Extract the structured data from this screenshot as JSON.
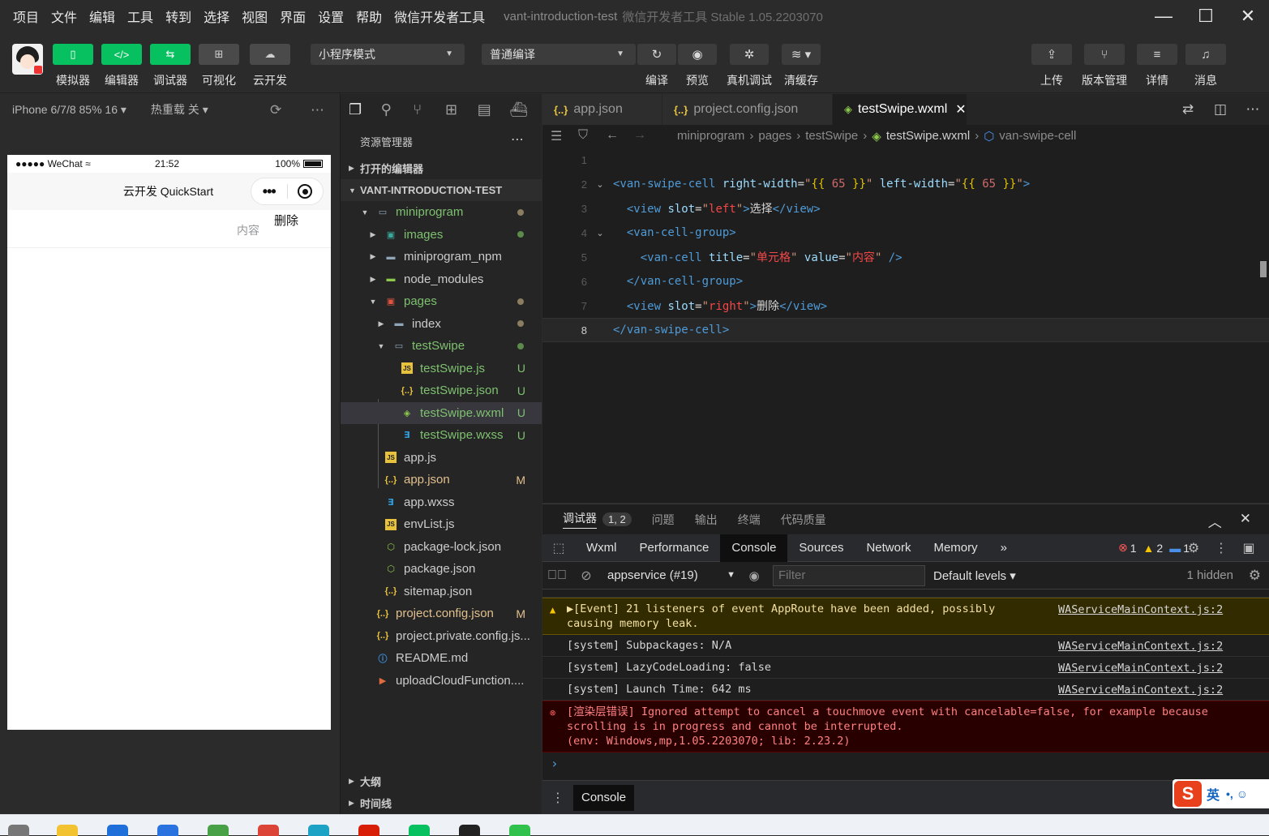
{
  "menubar": {
    "items": [
      "项目",
      "文件",
      "编辑",
      "工具",
      "转到",
      "选择",
      "视图",
      "界面",
      "设置",
      "帮助",
      "微信开发者工具"
    ],
    "title": "vant-introduction-test",
    "subtitle": "微信开发者工具 Stable 1.05.2203070",
    "controls": [
      "—",
      "☐",
      "✕"
    ]
  },
  "toolbar": {
    "left_buttons": [
      {
        "label": "模拟器",
        "icon": "phone-icon",
        "glyph": "▯",
        "active": true
      },
      {
        "label": "编辑器",
        "icon": "code-icon",
        "glyph": "</>",
        "active": true
      },
      {
        "label": "调试器",
        "icon": "debug-icon",
        "glyph": "⇆",
        "active": true
      },
      {
        "label": "可视化",
        "icon": "layout-icon",
        "glyph": "⊞",
        "active": false
      },
      {
        "label": "云开发",
        "icon": "cloud-icon",
        "glyph": "☁",
        "active": false
      }
    ],
    "mode_select": "小程序模式",
    "compile_select": "普通编译",
    "right_labels": [
      "编译",
      "预览",
      "真机调试",
      "清缓存"
    ],
    "far_right": [
      {
        "label": "上传",
        "icon": "upload-icon",
        "glyph": "⇪"
      },
      {
        "label": "版本管理",
        "icon": "branch-icon",
        "glyph": "⑂"
      },
      {
        "label": "详情",
        "icon": "menu-icon",
        "glyph": "≡"
      },
      {
        "label": "消息",
        "icon": "bell-icon",
        "glyph": "♫"
      }
    ]
  },
  "simulator": {
    "device": "iPhone 6/7/8 85% 16 ▾",
    "hot_reload": "热重载 关 ▾",
    "status": {
      "carrier": "●●●●● WeChat",
      "wifi": "≈",
      "time": "21:52",
      "battery": "100%"
    },
    "nav_title": "云开发 QuickStart",
    "cell_value": "内容",
    "delete_label": "删除"
  },
  "explorer": {
    "title": "资源管理器",
    "open_editors": "打开的编辑器",
    "project": "VANT-INTRODUCTION-TEST",
    "tree": [
      {
        "name": "miniprogram",
        "depth": 0,
        "arrow": "▼",
        "icon": "folder-open-icon",
        "color": "#7ec16f",
        "dot": "#8b7d60"
      },
      {
        "name": "images",
        "depth": 1,
        "arrow": "▶",
        "icon": "folder-image-icon",
        "color": "#7ec16f",
        "dot": "#5b8a4a"
      },
      {
        "name": "miniprogram_npm",
        "depth": 1,
        "arrow": "▶",
        "icon": "folder-icon",
        "color": "#cccccc"
      },
      {
        "name": "node_modules",
        "depth": 1,
        "arrow": "▶",
        "icon": "folder-node-icon",
        "color": "#cccccc"
      },
      {
        "name": "pages",
        "depth": 1,
        "arrow": "▼",
        "icon": "folder-pages-icon",
        "color": "#7ec16f",
        "dot": "#8b7d60"
      },
      {
        "name": "index",
        "depth": 2,
        "arrow": "▶",
        "icon": "folder-icon",
        "color": "#cccccc",
        "dot": "#8b7d60"
      },
      {
        "name": "testSwipe",
        "depth": 2,
        "arrow": "▼",
        "icon": "folder-open-icon",
        "color": "#7ec16f",
        "dot": "#5b8a4a"
      },
      {
        "name": "testSwipe.js",
        "depth": 3,
        "icon": "js-file-icon",
        "color": "#7ec16f",
        "status": "U",
        "status_color": "#7ec16f"
      },
      {
        "name": "testSwipe.json",
        "depth": 3,
        "icon": "json-file-icon",
        "color": "#7ec16f",
        "status": "U",
        "status_color": "#7ec16f"
      },
      {
        "name": "testSwipe.wxml",
        "depth": 3,
        "icon": "wxml-file-icon",
        "color": "#7ec16f",
        "status": "U",
        "status_color": "#7ec16f",
        "selected": true
      },
      {
        "name": "testSwipe.wxss",
        "depth": 3,
        "icon": "wxss-file-icon",
        "color": "#7ec16f",
        "status": "U",
        "status_color": "#7ec16f"
      },
      {
        "name": "app.js",
        "depth": 1,
        "icon": "js-file-icon",
        "color": "#cccccc"
      },
      {
        "name": "app.json",
        "depth": 1,
        "icon": "json-file-icon",
        "color": "#e2c08d",
        "status": "M",
        "status_color": "#e2c08d"
      },
      {
        "name": "app.wxss",
        "depth": 1,
        "icon": "wxss-file-icon",
        "color": "#cccccc"
      },
      {
        "name": "envList.js",
        "depth": 1,
        "icon": "js-file-icon",
        "color": "#cccccc"
      },
      {
        "name": "package-lock.json",
        "depth": 1,
        "icon": "node-file-icon",
        "color": "#cccccc"
      },
      {
        "name": "package.json",
        "depth": 1,
        "icon": "node-file-icon",
        "color": "#cccccc"
      },
      {
        "name": "sitemap.json",
        "depth": 1,
        "icon": "json-file-icon",
        "color": "#cccccc"
      },
      {
        "name": "project.config.json",
        "depth": 0,
        "icon": "json-file-icon",
        "color": "#e2c08d",
        "status": "M",
        "status_color": "#e2c08d"
      },
      {
        "name": "project.private.config.js...",
        "depth": 0,
        "icon": "json-file-icon",
        "color": "#cccccc"
      },
      {
        "name": "README.md",
        "depth": 0,
        "icon": "info-file-icon",
        "color": "#cccccc"
      },
      {
        "name": "uploadCloudFunction....",
        "depth": 0,
        "icon": "shell-file-icon",
        "color": "#cccccc"
      }
    ],
    "outline": "大纲",
    "timeline": "时间线"
  },
  "editor": {
    "tabs": [
      {
        "name": "app.json",
        "icon": "json-file-icon",
        "glyph": "{..}",
        "active": false
      },
      {
        "name": "project.config.json",
        "icon": "json-file-icon",
        "glyph": "{..}",
        "active": false
      },
      {
        "name": "testSwipe.wxml",
        "icon": "wxml-file-icon",
        "glyph": "◈",
        "active": true
      }
    ],
    "breadcrumb": [
      "miniprogram",
      "pages",
      "testSwipe",
      "testSwipe.wxml",
      "van-swipe-cell"
    ],
    "current_line": 8,
    "lines": [
      {
        "n": "1",
        "tokens": []
      },
      {
        "n": "2",
        "fold": "⌄",
        "tokens": [
          [
            "tg",
            "<van-swipe-cell "
          ],
          [
            "at",
            "right-width"
          ],
          [
            "eq",
            "="
          ],
          [
            "sv",
            "\""
          ],
          [
            "br",
            "{{"
          ],
          [
            "nb",
            " 65 "
          ],
          [
            "br",
            "}}"
          ],
          [
            "sv",
            "\""
          ],
          [
            "at",
            " left-width"
          ],
          [
            "eq",
            "="
          ],
          [
            "sv",
            "\""
          ],
          [
            "br",
            "{{"
          ],
          [
            "nb",
            " 65 "
          ],
          [
            "br",
            "}}"
          ],
          [
            "sv",
            "\""
          ],
          [
            "tg",
            ">"
          ]
        ]
      },
      {
        "n": "3",
        "tokens": [
          [
            "tx",
            "  "
          ],
          [
            "tg",
            "<view "
          ],
          [
            "at",
            "slot"
          ],
          [
            "eq",
            "="
          ],
          [
            "sv",
            "\""
          ],
          [
            "sr",
            "left"
          ],
          [
            "sv",
            "\""
          ],
          [
            "tg",
            ">"
          ],
          [
            "tx",
            "选择"
          ],
          [
            "tg",
            "</view>"
          ]
        ]
      },
      {
        "n": "4",
        "fold": "⌄",
        "tokens": [
          [
            "tx",
            "  "
          ],
          [
            "tg",
            "<van-cell-group>"
          ]
        ]
      },
      {
        "n": "5",
        "tokens": [
          [
            "tx",
            "    "
          ],
          [
            "tg",
            "<van-cell "
          ],
          [
            "at",
            "title"
          ],
          [
            "eq",
            "="
          ],
          [
            "sv",
            "\""
          ],
          [
            "sr",
            "单元格"
          ],
          [
            "sv",
            "\""
          ],
          [
            "at",
            " value"
          ],
          [
            "eq",
            "="
          ],
          [
            "sv",
            "\""
          ],
          [
            "sr",
            "内容"
          ],
          [
            "sv",
            "\""
          ],
          [
            "tg",
            " />"
          ]
        ]
      },
      {
        "n": "6",
        "tokens": [
          [
            "tx",
            "  "
          ],
          [
            "tg",
            "</van-cell-group>"
          ]
        ]
      },
      {
        "n": "7",
        "tokens": [
          [
            "tx",
            "  "
          ],
          [
            "tg",
            "<view "
          ],
          [
            "at",
            "slot"
          ],
          [
            "eq",
            "="
          ],
          [
            "sv",
            "\""
          ],
          [
            "sr",
            "right"
          ],
          [
            "sv",
            "\""
          ],
          [
            "tg",
            ">"
          ],
          [
            "tx",
            "删除"
          ],
          [
            "tg",
            "</view>"
          ]
        ]
      },
      {
        "n": "8",
        "tokens": [
          [
            "tg",
            "</van-swipe-cell>"
          ]
        ]
      }
    ]
  },
  "debugger": {
    "panel_tabs": [
      "调试器",
      "问题",
      "输出",
      "终端",
      "代码质量"
    ],
    "badge": "1, 2",
    "devtools_tabs": [
      "Wxml",
      "Performance",
      "Console",
      "Sources",
      "Network",
      "Memory"
    ],
    "more": "»",
    "counts": {
      "errors": "1",
      "warnings": "2",
      "info": "1"
    },
    "context": "appservice (#19)",
    "filter_placeholder": "Filter",
    "levels": "Default levels ▾",
    "hidden": "1 hidden",
    "messages": [
      {
        "type": "warn",
        "text": "▶[Event] 21 listeners of event AppRoute have been added, possibly\ncausing memory leak.",
        "source": "WAServiceMainContext.js:2"
      },
      {
        "type": "log",
        "text": "[system] Subpackages: N/A",
        "source": "WAServiceMainContext.js:2"
      },
      {
        "type": "log",
        "text": "[system] LazyCodeLoading: false",
        "source": "WAServiceMainContext.js:2"
      },
      {
        "type": "log",
        "text": "[system] Launch Time: 642 ms",
        "source": "WAServiceMainContext.js:2"
      },
      {
        "type": "err",
        "text": "[渲染层错误] Ignored attempt to cancel a touchmove event with cancelable=false, for example because\nscrolling is in progress and cannot be interrupted.\n(env: Windows,mp,1.05.2203070; lib: 2.23.2)",
        "source": ""
      }
    ],
    "prompt": "›",
    "drawer_tab": "Console"
  },
  "ime": {
    "label": "英",
    "extra": "•, ☺"
  },
  "colors": {
    "accent_green": "#07c160",
    "error": "#ff8080",
    "warning": "#f2e0a3"
  }
}
